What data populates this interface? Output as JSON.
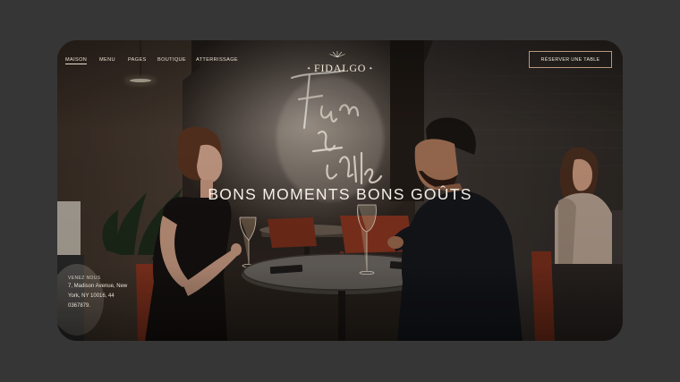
{
  "nav": {
    "items": [
      {
        "label": "MAISON",
        "active": true
      },
      {
        "label": "MENU",
        "active": false
      },
      {
        "label": "PAGES",
        "active": false
      },
      {
        "label": "BOUTIQUE",
        "active": false
      },
      {
        "label": "ATTERRISSAGE",
        "active": false
      }
    ]
  },
  "brand": {
    "name": "FIDALGO"
  },
  "reserve_button": {
    "label": "RÉSERVER UNE TABLE"
  },
  "hero": {
    "headline": "BONS MOMENTS BONS GOÛTS"
  },
  "visit": {
    "label": "VENEZ NOUS",
    "address_lines": [
      "7, Madison Avenue, New",
      "York, NY 10016, 44",
      "0367879."
    ]
  },
  "colors": {
    "outer_background": "#363636",
    "nav_text": "#e9dfcf",
    "button_border": "#b9977c",
    "neon": "#f6ebdd"
  }
}
